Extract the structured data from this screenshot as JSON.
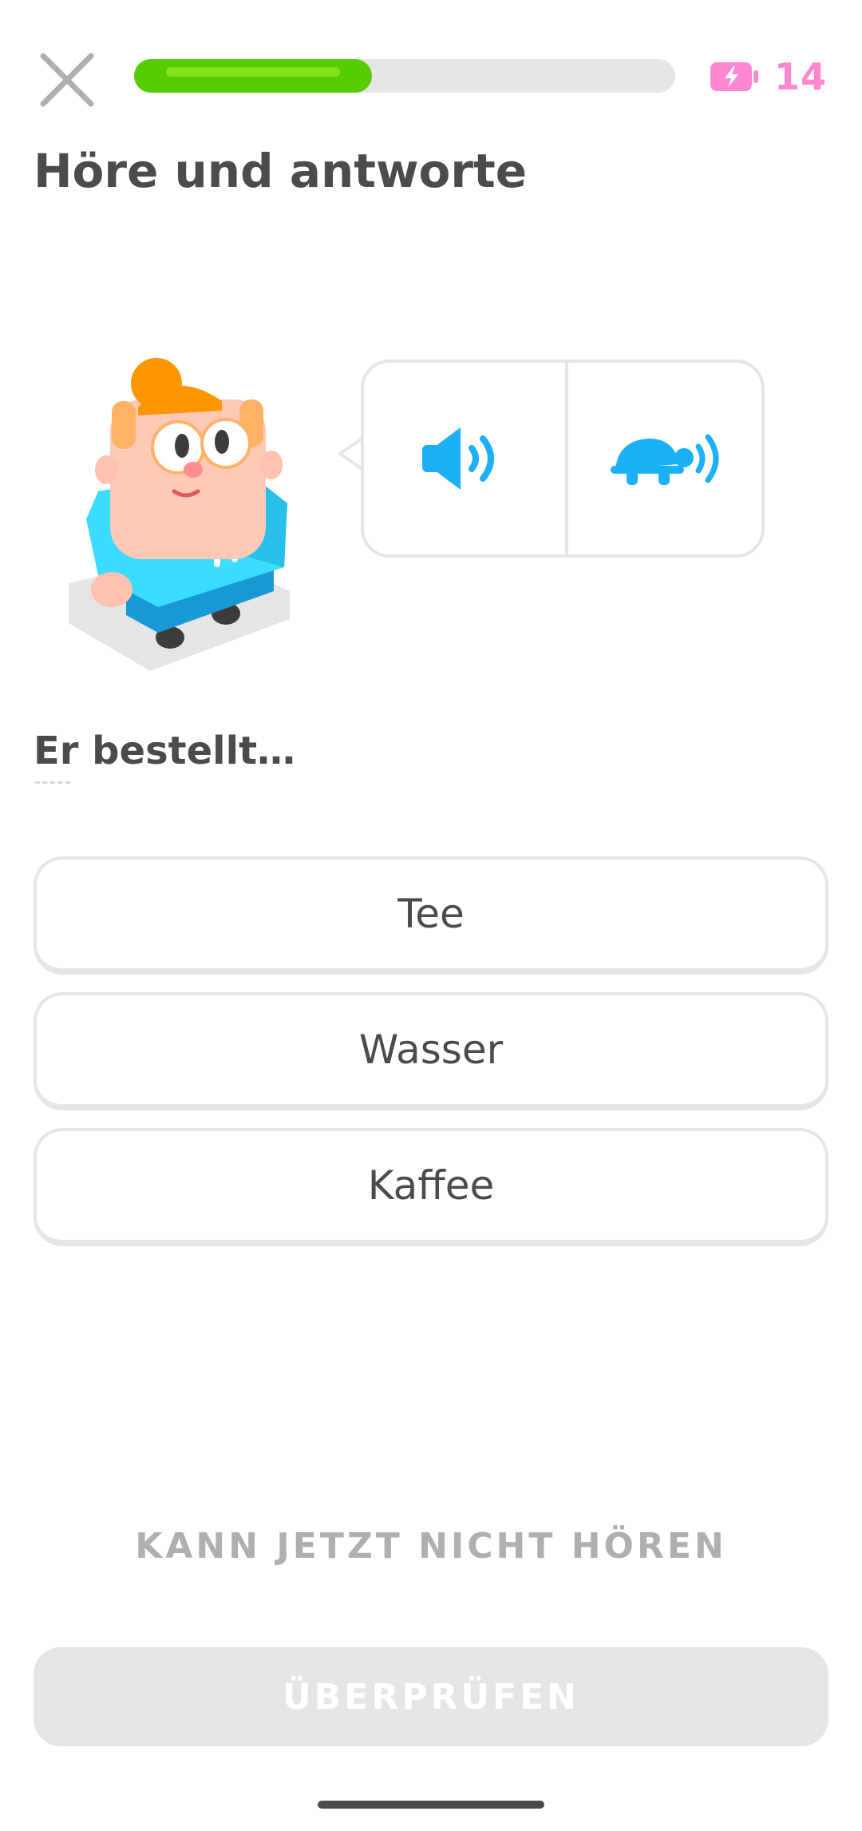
{
  "header": {
    "progress": 0.44,
    "energy_count": "14"
  },
  "title": "Höre und antworte",
  "prompt": "Er bestellt…",
  "audio_buttons": {
    "normal_icon": "speaker-icon",
    "slow_icon": "turtle-speaker-icon"
  },
  "choices": [
    {
      "label": "Tee"
    },
    {
      "label": "Wasser"
    },
    {
      "label": "Kaffee"
    }
  ],
  "footer": {
    "cant_listen_label": "KANN JETZT NICHT HÖREN",
    "check_label": "ÜBERPRÜFEN"
  },
  "colors": {
    "progress_green": "#58cc02",
    "energy_pink": "#ff86d0",
    "audio_blue": "#1cb0f6",
    "disabled_gray": "#e5e5e5"
  }
}
